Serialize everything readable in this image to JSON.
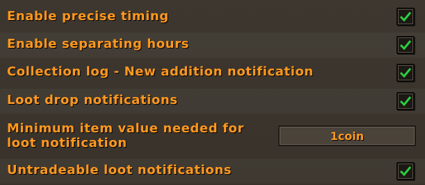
{
  "settings": [
    {
      "label": "Enable precise timing",
      "checked": true
    },
    {
      "label": "Enable separating hours",
      "checked": true
    },
    {
      "label": "Collection log - New addition notification",
      "checked": true
    },
    {
      "label": "Loot drop notifications",
      "checked": true
    },
    {
      "label": "Minimum item value needed for loot notification",
      "value": "1coin"
    },
    {
      "label": "Untradeable loot notifications",
      "checked": true
    }
  ],
  "colors": {
    "text": "#ff981f",
    "check": "#2ecc40",
    "background": "#3b352e"
  },
  "icons": {
    "checkbox": "checkmark-icon"
  }
}
